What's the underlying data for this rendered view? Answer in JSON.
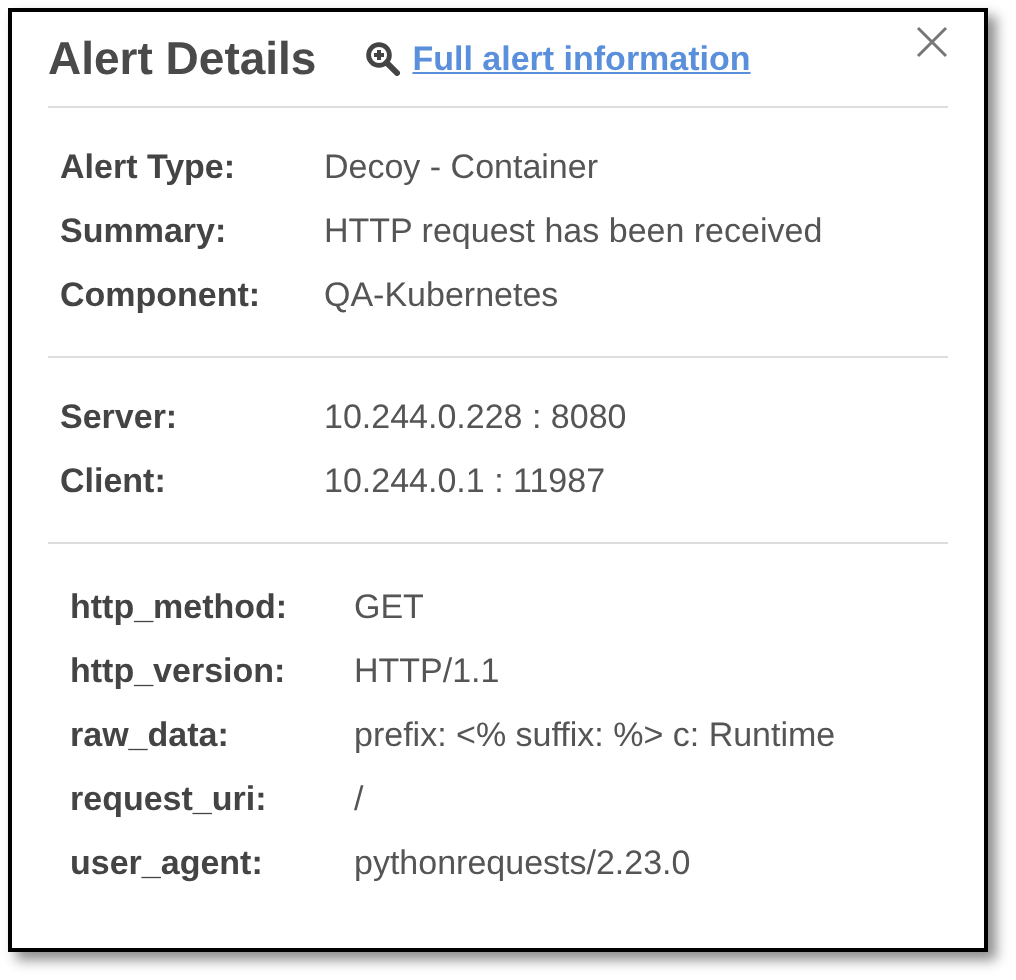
{
  "header": {
    "title": "Alert Details",
    "link": "Full alert information"
  },
  "sections": [
    {
      "kind": "summary",
      "fields": [
        {
          "label": "Alert Type:",
          "value": "Decoy - Container"
        },
        {
          "label": "Summary:",
          "value": "HTTP request has been received"
        },
        {
          "label": "Component:",
          "value": "QA-Kubernetes"
        }
      ]
    },
    {
      "kind": "summary",
      "fields": [
        {
          "label": "Server:",
          "value": "10.244.0.228 : 8080"
        },
        {
          "label": "Client:",
          "value": "10.244.0.1 : 11987"
        }
      ]
    },
    {
      "kind": "attributes",
      "fields": [
        {
          "label": "http_method:",
          "value": "GET"
        },
        {
          "label": "http_version:",
          "value": "HTTP/1.1"
        },
        {
          "label": "raw_data:",
          "value": "prefix: <% suffix: %> c: Runtime"
        },
        {
          "label": "request_uri:",
          "value": "/"
        },
        {
          "label": "user_agent:",
          "value": "pythonrequests/2.23.0"
        }
      ]
    }
  ]
}
